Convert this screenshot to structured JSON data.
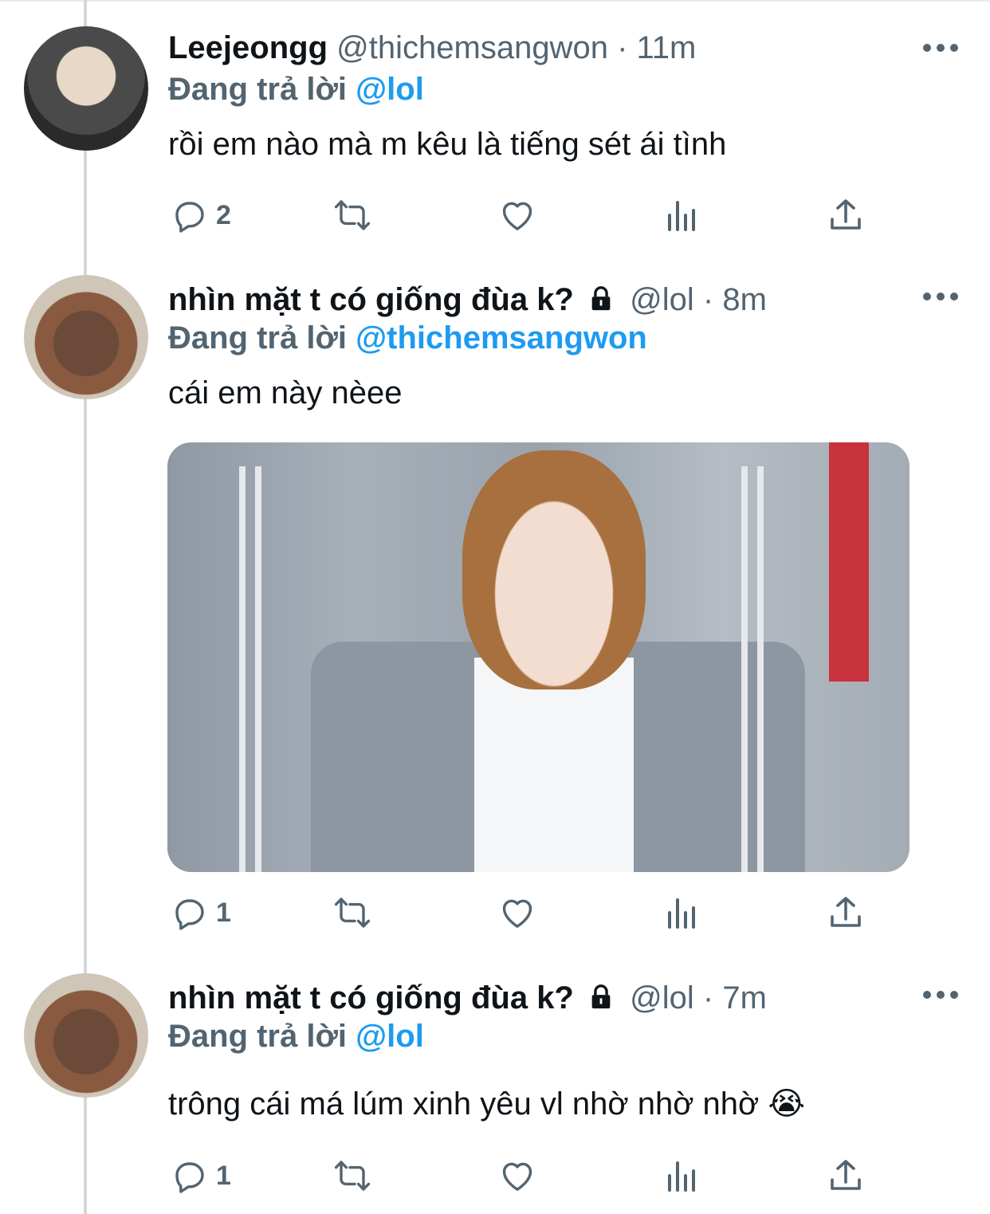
{
  "tweets": [
    {
      "name": "Leejeongg",
      "handle": "@thichemsangwon",
      "dot": "·",
      "time": "11m",
      "locked": false,
      "replying_prefix": "Đang trả lời",
      "replying_to": "@lol",
      "text": "rồi em nào mà m kêu là tiếng sét ái tình",
      "reply_count": "2",
      "has_media": false
    },
    {
      "name": "nhìn mặt t có giống đùa k?",
      "handle": "@lol",
      "dot": "·",
      "time": "8m",
      "locked": true,
      "replying_prefix": "Đang trả lời",
      "replying_to": "@thichemsangwon",
      "text": "cái em này nèee",
      "reply_count": "1",
      "has_media": true
    },
    {
      "name": "nhìn mặt t có giống đùa k?",
      "handle": "@lol",
      "dot": "·",
      "time": "7m",
      "locked": true,
      "replying_prefix": "Đang trả lời",
      "replying_to": "@lol",
      "text": "trông cái má lúm xinh yêu vl nhờ nhờ nhờ 😭",
      "reply_count": "1",
      "has_media": false
    }
  ],
  "icons": {
    "reply": "reply-icon",
    "retweet": "retweet-icon",
    "like": "heart-icon",
    "views": "analytics-icon",
    "share": "share-icon",
    "more": "more-icon",
    "lock": "lock-icon"
  },
  "colors": {
    "mention": "#1d9bf0",
    "secondary_text": "#536471",
    "primary_text": "#0f1419",
    "thread_line": "#d3d7db"
  }
}
